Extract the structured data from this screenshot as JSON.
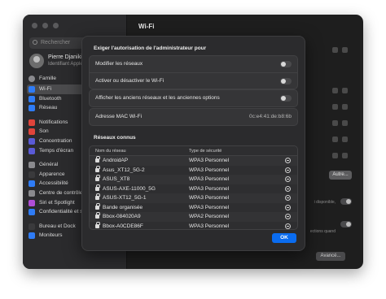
{
  "window": {
    "title": "Wi-Fi"
  },
  "sidebar": {
    "search_placeholder": "Rechercher",
    "profile": {
      "name": "Pierre Djaniki",
      "subtitle": "Identifiant Apple"
    },
    "family": "Famille",
    "groups": [
      [
        {
          "label": "Wi-Fi",
          "color": "#2f7cf6",
          "active": true
        },
        {
          "label": "Bluetooth",
          "color": "#2f7cf6"
        },
        {
          "label": "Réseau",
          "color": "#2f7cf6"
        }
      ],
      [
        {
          "label": "Notifications",
          "color": "#e0443b"
        },
        {
          "label": "Son",
          "color": "#e0443b"
        },
        {
          "label": "Concentration",
          "color": "#5a5ad6"
        },
        {
          "label": "Temps d'écran",
          "color": "#5a5ad6"
        }
      ],
      [
        {
          "label": "Général",
          "color": "#8a8a8e"
        },
        {
          "label": "Apparence",
          "color": "#3a3a3c"
        },
        {
          "label": "Accessibilité",
          "color": "#2f7cf6"
        },
        {
          "label": "Centre de contrôle",
          "color": "#8a8a8e"
        },
        {
          "label": "Siri et Spotlight",
          "color": "#b04ed6"
        },
        {
          "label": "Confidentialité et sécurité",
          "color": "#2f7cf6"
        }
      ],
      [
        {
          "label": "Bureau et Dock",
          "color": "#3a3a3c"
        },
        {
          "label": "Moniteurs",
          "color": "#2f7cf6"
        }
      ]
    ]
  },
  "background": {
    "other_button": "Autre...",
    "advanced_button": "Avancé...",
    "hint_1": "i disponible,",
    "hint_2": "ections quand"
  },
  "dialog": {
    "title": "Exiger l'autorisation de l'administrateur pour",
    "options": [
      {
        "label": "Modifier les réseaux",
        "on": false
      },
      {
        "label": "Activer ou désactiver le Wi-Fi",
        "on": false
      }
    ],
    "legacy_option": {
      "label": "Afficher les anciens réseaux et les anciennes options",
      "on": false
    },
    "mac": {
      "label": "Adresse MAC Wi-Fi",
      "value": "0c:e4:41:de:b8:6b"
    },
    "known_networks_title": "Réseaux connus",
    "table": {
      "col_name": "Nom du réseau",
      "col_security": "Type de sécurité",
      "rows": [
        {
          "name": "AndroidAP",
          "security": "WPA3 Personnel"
        },
        {
          "name": "Asus_XT12_5G-2",
          "security": "WPA3 Personnel"
        },
        {
          "name": "ASUS_XT8",
          "security": "WPA3 Personnel"
        },
        {
          "name": "ASUS-AXE-11000_5G",
          "security": "WPA3 Personnel"
        },
        {
          "name": "ASUS-XT12_5G-1",
          "security": "WPA3 Personnel"
        },
        {
          "name": "Bande organisée",
          "security": "WPA3 Personnel"
        },
        {
          "name": "Bbox-084020A9",
          "security": "WPA2 Personnel"
        },
        {
          "name": "Bbox-A0CDE86F",
          "security": "WPA3 Personnel"
        }
      ]
    },
    "ok_label": "OK"
  },
  "colors": {
    "accent": "#0a6cf0"
  }
}
